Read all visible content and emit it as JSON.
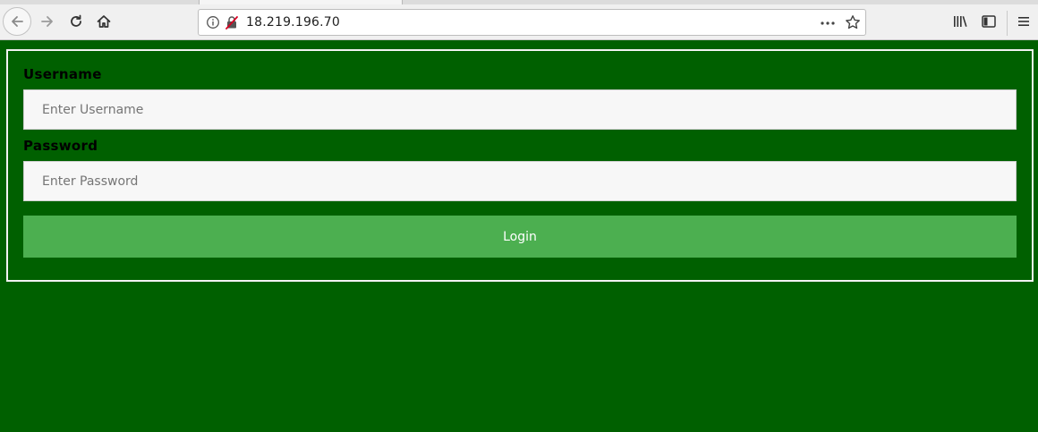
{
  "browser": {
    "url": "18.219.196.70",
    "icons": [
      "back-arrow-icon",
      "forward-arrow-icon",
      "reload-icon",
      "home-icon",
      "info-icon",
      "insecure-lock-icon",
      "page-actions-icon",
      "bookmark-star-icon",
      "library-icon",
      "sidebar-icon",
      "menu-icon"
    ],
    "colors": {
      "toolbar": "#f0f0f0",
      "urlbar": "#ffffff"
    }
  },
  "login": {
    "username_label": "Username",
    "username_placeholder": "Enter Username",
    "username_value": "",
    "password_label": "Password",
    "password_placeholder": "Enter Password",
    "password_value": "",
    "submit_label": "Login"
  },
  "colors": {
    "page_background": "#006000",
    "button_background": "#4caf50",
    "box_border": "#f2f2f2"
  }
}
